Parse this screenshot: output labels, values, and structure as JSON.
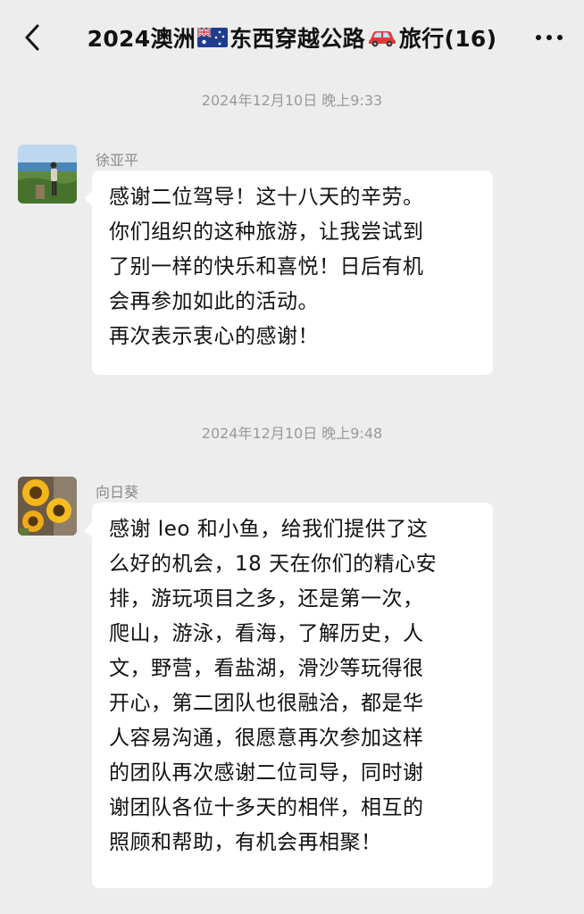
{
  "header": {
    "title_part1": "2024澳洲",
    "title_part2": "东西穿越公路",
    "title_part3": "旅行(16)",
    "back_icon": "chevron-left-icon",
    "more_icon": "more-dots-icon"
  },
  "messages": [
    {
      "timestamp": "2024年12月10日 晚上9:33",
      "sender": "徐亚平",
      "lines": [
        "感谢二位驾导！这十八天的辛劳。",
        "你们组织的这种旅游，让我尝试到",
        "了别一样的快乐和喜悦！日后有机",
        "会再参加如此的活动。",
        "再次表示衷心的感谢！"
      ]
    },
    {
      "timestamp": "2024年12月10日 晚上9:48",
      "sender": "向日葵",
      "lines": [
        "感谢 leo 和小鱼，给我们提供了这",
        "么好的机会，18 天在你们的精心安",
        "排，游玩项目之多，还是第一次，",
        "爬山，游泳，看海，了解历史，人",
        "文，野营，看盐湖，滑沙等玩得很",
        "开心，第二团队也很融洽，都是华",
        "人容易沟通，很愿意再次参加这样",
        "的团队再次感谢二位司导，同时谢",
        "谢团队各位十多天的相伴，相互的",
        "照顾和帮助，有机会再相聚！"
      ]
    }
  ],
  "colors": {
    "background": "#ededed",
    "bubble": "#ffffff",
    "timestamp": "#9a9a9a",
    "sender": "#8a8a8a"
  }
}
